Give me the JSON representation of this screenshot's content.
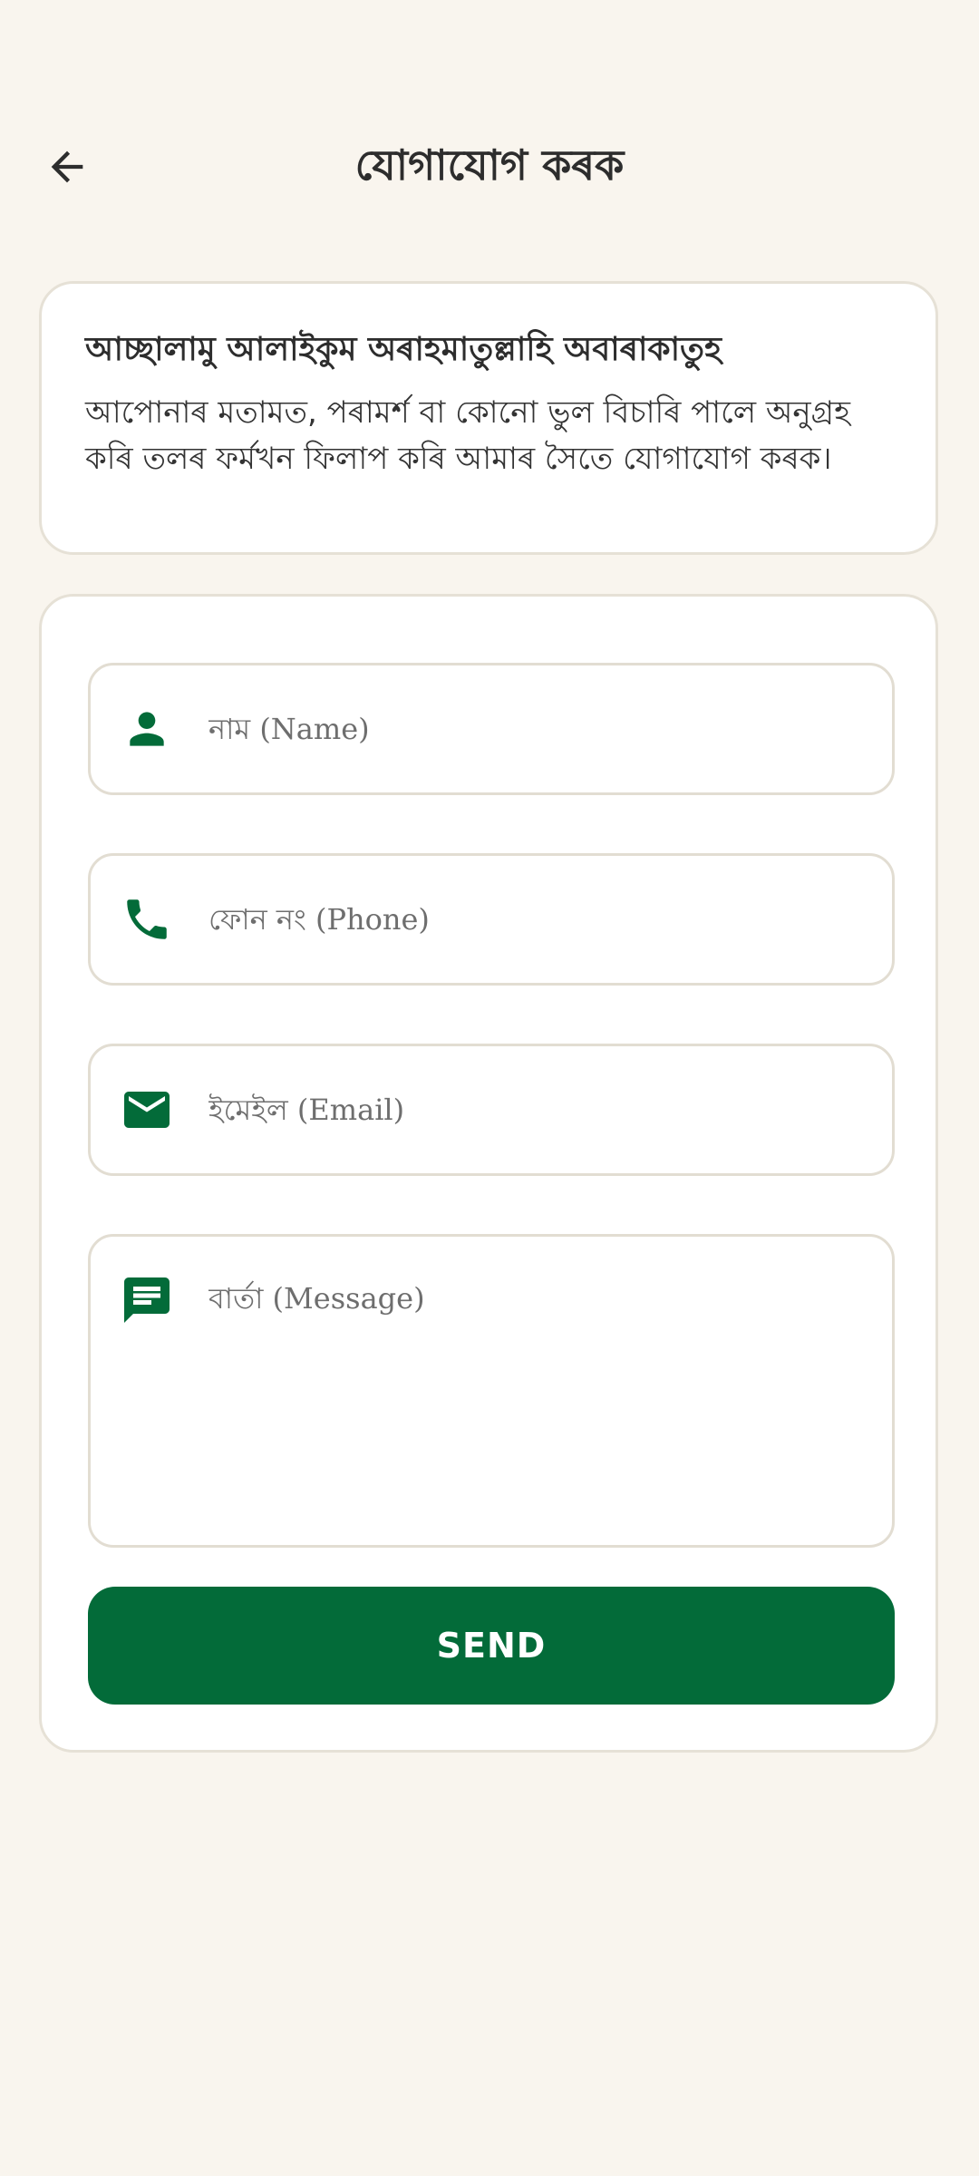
{
  "header": {
    "title": "যোগাযোগ কৰক",
    "back_icon": "arrow-left-icon"
  },
  "intro": {
    "greeting": "আচ্ছালামু আলাইকুম অৰাহমাতুল্লাহি অবাৰাকাতুহ",
    "description": "আপোনাৰ মতামত, পৰামৰ্শ বা কোনো ভুল বিচাৰি পালে অনুগ্ৰহ কৰি তলৰ ফৰ্মখন ফিলাপ কৰি আমাৰ সৈতে যোগাযোগ কৰক।"
  },
  "form": {
    "name": {
      "placeholder": "নাম (Name)",
      "value": "",
      "icon": "person-icon"
    },
    "phone": {
      "placeholder": "ফোন নং (Phone)",
      "value": "",
      "icon": "phone-icon"
    },
    "email": {
      "placeholder": "ইমেইল (Email)",
      "value": "",
      "icon": "mail-icon"
    },
    "message": {
      "placeholder": "বাৰ্তা (Message)",
      "value": "",
      "icon": "message-icon"
    },
    "send_label": "SEND"
  },
  "colors": {
    "background": "#f9f5ee",
    "accent": "#036b39",
    "card": "#ffffff",
    "border": "#e6e1d6"
  }
}
